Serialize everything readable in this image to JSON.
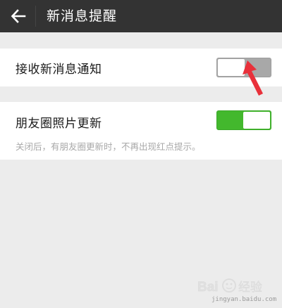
{
  "header": {
    "title": "新消息提醒"
  },
  "settings": {
    "receive_new_messages": {
      "label": "接收新消息通知",
      "enabled": false
    },
    "moments_updates": {
      "label": "朋友圈照片更新",
      "description": "关闭后，有朋友圈更新时，不再出现红点提示。",
      "enabled": true
    }
  },
  "watermark": {
    "logo_text": "Baidu经验",
    "url": "jingyan.baidu.com"
  },
  "colors": {
    "header_bg": "#333333",
    "toggle_on": "#43b82d",
    "toggle_off": "#a8a8a8",
    "annotation": "#e8303a"
  },
  "icons": {
    "back": "arrow-left-icon",
    "annotation": "red-pointer-arrow"
  }
}
